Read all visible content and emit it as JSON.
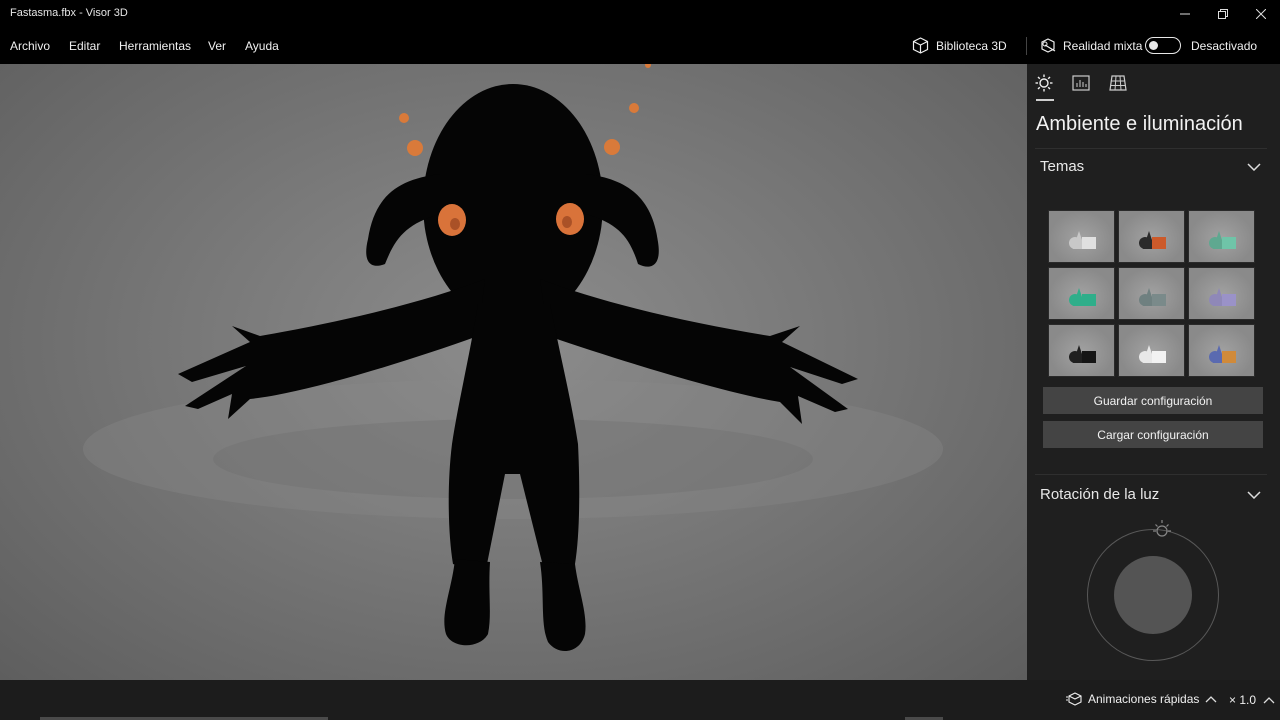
{
  "window": {
    "title": "Fastasma.fbx - Visor 3D"
  },
  "menu": {
    "items": [
      "Archivo",
      "Editar",
      "Herramientas",
      "Ver",
      "Ayuda"
    ]
  },
  "toolbar": {
    "library_label": "Biblioteca 3D",
    "mixed_reality_label": "Realidad mixta",
    "mixed_reality_state": "Desactivado"
  },
  "panel": {
    "title": "Ambiente e iluminación",
    "tabs": [
      "sun-icon",
      "stats-icon",
      "grid-icon"
    ],
    "themes_section": {
      "heading": "Temas",
      "themes": [
        {
          "bg": "#8a8a8a",
          "accent": "#e0e0e0",
          "shape": "#c8c8c8"
        },
        {
          "bg": "#8a8a8a",
          "accent": "#cc5a2a",
          "shape": "#2a2a2a"
        },
        {
          "bg": "#8a8a8a",
          "accent": "#6fc4a8",
          "shape": "#5fa890"
        },
        {
          "bg": "#8a8a8a",
          "accent": "#2fae8a",
          "shape": "#2fae8a"
        },
        {
          "bg": "#8a8a8a",
          "accent": "#7a8a8a",
          "shape": "#6f8080"
        },
        {
          "bg": "#8a8a8a",
          "accent": "#9a92c8",
          "shape": "#8f88b8"
        },
        {
          "bg": "#8a8a8a",
          "accent": "#151515",
          "shape": "#202020"
        },
        {
          "bg": "#8a8a8a",
          "accent": "#f2f2f2",
          "shape": "#e8e8e8"
        },
        {
          "bg": "#8a8a8a",
          "accent": "#d08a3a",
          "shape": "#5a6ab0"
        }
      ],
      "save_button": "Guardar configuración",
      "load_button": "Cargar configuración"
    },
    "light_section": {
      "heading": "Rotación de la luz"
    }
  },
  "bottom": {
    "animations_label": "Animaciones rápidas",
    "speed_label": "× 1.0"
  }
}
